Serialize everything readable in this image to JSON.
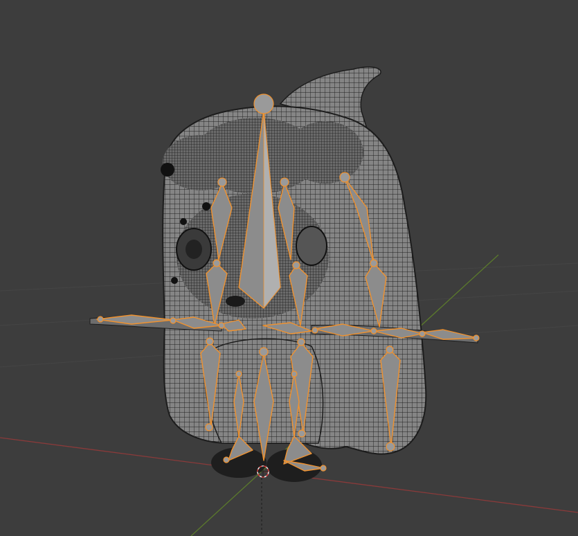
{
  "viewport": {
    "mode": "wireframe",
    "background": "#3d3d3d",
    "mesh_color": "#7c7c7c",
    "wire_color": "#1c1c1c",
    "selection_color": "#f0922f",
    "x_axis_color": "#8a3a3a",
    "y_axis_color": "#5b7a2c"
  },
  "scene": {
    "object": "wireframe-character-mesh",
    "armature": "selected-armature",
    "cursor": "3d-cursor-icon"
  }
}
